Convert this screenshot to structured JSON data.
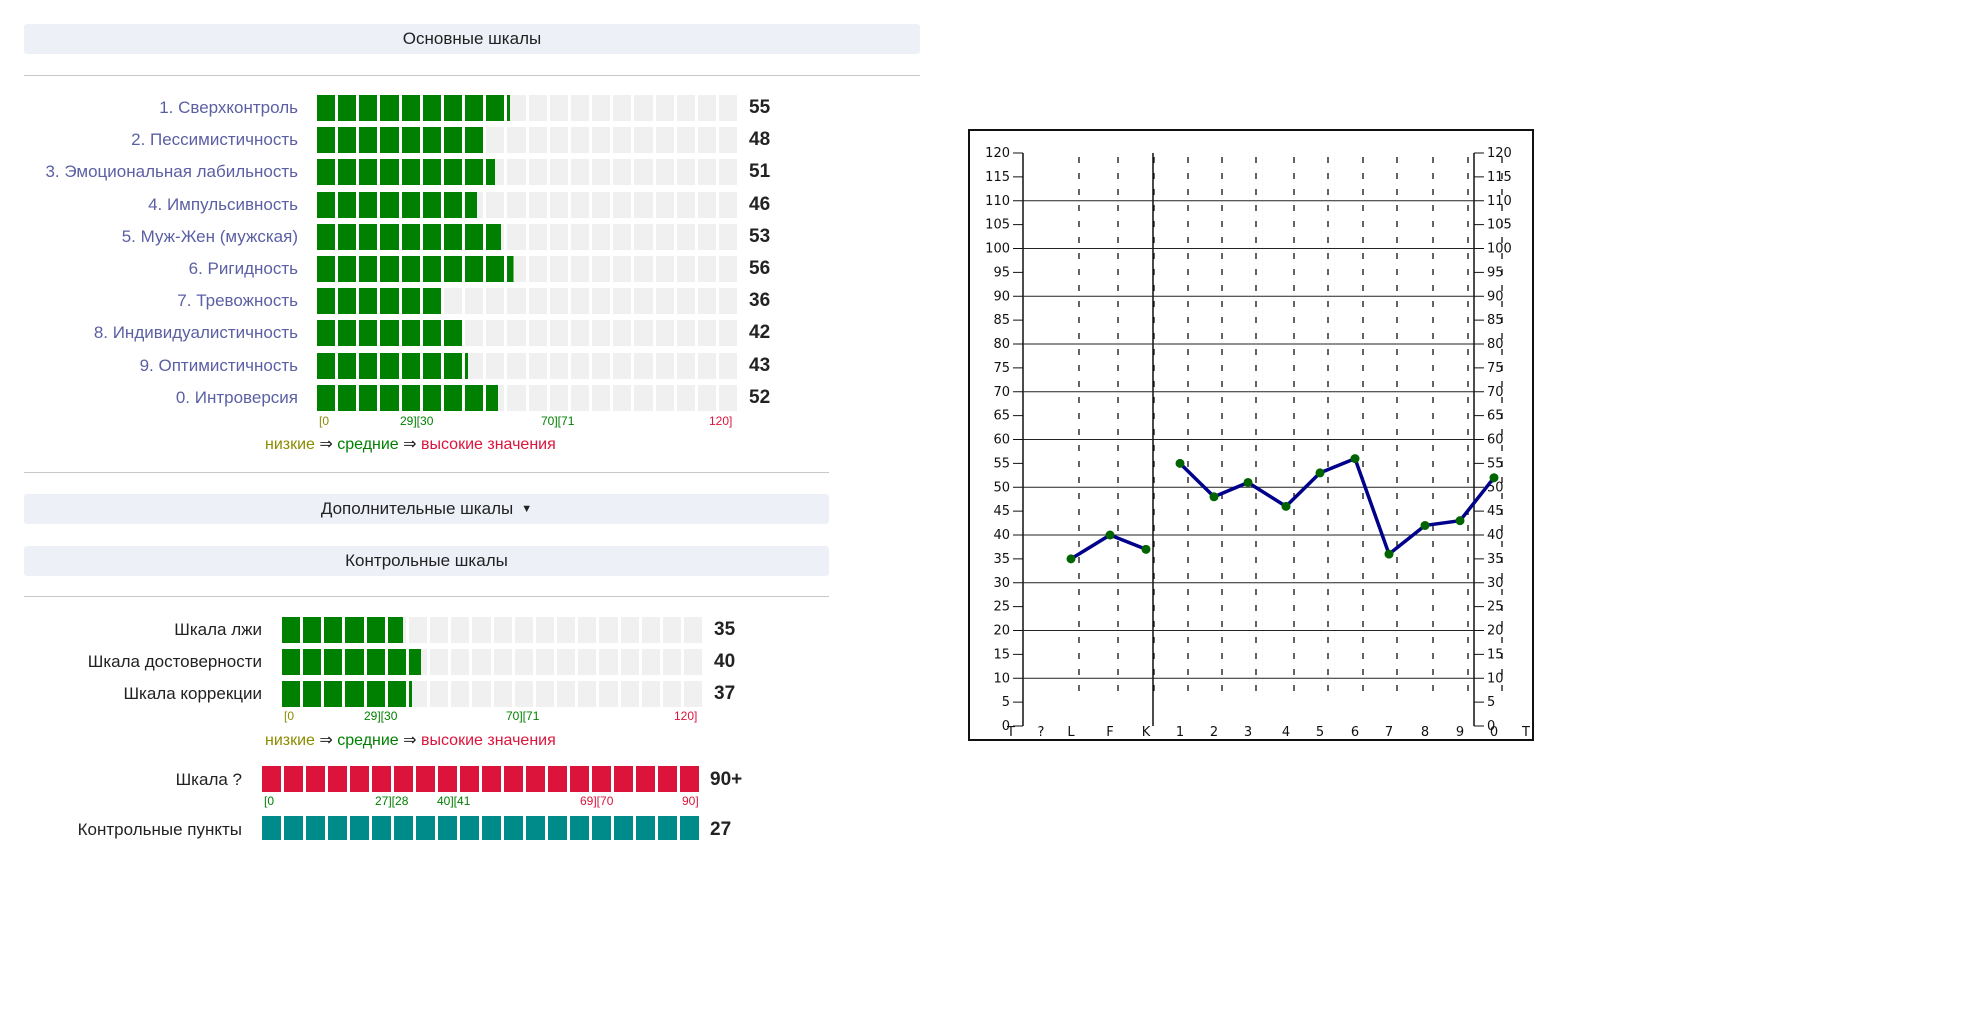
{
  "colors": {
    "fill_green": "#008000",
    "fill_red": "#dc143c",
    "fill_teal": "#008b8b",
    "track": "#f0f0f0",
    "label_blue": "#5b5fa4",
    "low": "#8b8b00",
    "mid": "#008000",
    "high": "#dc143c",
    "plot_line": "#00008b",
    "plot_point": "#006400"
  },
  "main_section": {
    "title": "Основные шкалы",
    "range_max": 120,
    "scales": [
      {
        "label": "1. Сверхконтроль",
        "value": 55
      },
      {
        "label": "2. Пессимистичность",
        "value": 48
      },
      {
        "label": "3. Эмоциональная лабильность",
        "value": 51
      },
      {
        "label": "4. Импульсивность",
        "value": 46
      },
      {
        "label": "5. Муж-Жен (мужская)",
        "value": 53
      },
      {
        "label": "6. Ригидность",
        "value": 56
      },
      {
        "label": "7. Тревожность",
        "value": 36
      },
      {
        "label": "8. Индивидуалистичность",
        "value": 42
      },
      {
        "label": "9. Оптимистичность",
        "value": 43
      },
      {
        "label": "0. Интроверсия",
        "value": 52
      }
    ],
    "ticks": {
      "t0": "[0",
      "t29": "29][30",
      "t70": "70][71",
      "t120": "120]"
    },
    "legend": {
      "low": "низкие",
      "arrow1": " ⇒ ",
      "mid": "средние",
      "arrow2": " ⇒ ",
      "high": "высокие значения"
    }
  },
  "additional_section": {
    "title": "Дополнительные шкалы",
    "caret": "▼"
  },
  "control_section": {
    "title": "Контрольные шкалы",
    "range_max": 120,
    "scales": [
      {
        "label": "Шкала лжи",
        "value": 35
      },
      {
        "label": "Шкала достоверности",
        "value": 40
      },
      {
        "label": "Шкала коррекции",
        "value": 37
      }
    ],
    "ticks": {
      "t0": "[0",
      "t29": "29][30",
      "t70": "70][71",
      "t120": "120]"
    },
    "legend": {
      "low": "низкие",
      "arrow1": " ⇒ ",
      "mid": "средние",
      "arrow2": " ⇒ ",
      "high": "высокие значения"
    },
    "question_scale": {
      "label": "Шкала ?",
      "value_text": "90+",
      "fill_fraction": 1.0,
      "ticks": {
        "t0": "[0",
        "t27": "27][28",
        "t40": "40][41",
        "t69": "69][70",
        "t90": "90]"
      }
    },
    "control_points": {
      "label": "Контрольные пункты",
      "value_text": "27",
      "fill_fraction": 1.0
    }
  },
  "chart_data": {
    "type": "line",
    "x": [
      "T",
      "?",
      "L",
      "F",
      "K",
      "1",
      "2",
      "3",
      "4",
      "5",
      "6",
      "7",
      "8",
      "9",
      "0",
      "T"
    ],
    "y_ticks": [
      0,
      5,
      10,
      15,
      20,
      25,
      30,
      35,
      40,
      45,
      50,
      55,
      60,
      65,
      70,
      75,
      80,
      85,
      90,
      95,
      100,
      105,
      110,
      115,
      120
    ],
    "ylim": [
      0,
      120
    ],
    "series": [
      {
        "segment": [
          "L",
          "F",
          "K"
        ],
        "values": [
          35,
          40,
          37
        ]
      },
      {
        "segment": [
          "1",
          "2",
          "3",
          "4",
          "5",
          "6",
          "7",
          "8",
          "9",
          "0"
        ],
        "values": [
          55,
          48,
          51,
          46,
          53,
          56,
          36,
          42,
          43,
          52
        ]
      }
    ]
  }
}
